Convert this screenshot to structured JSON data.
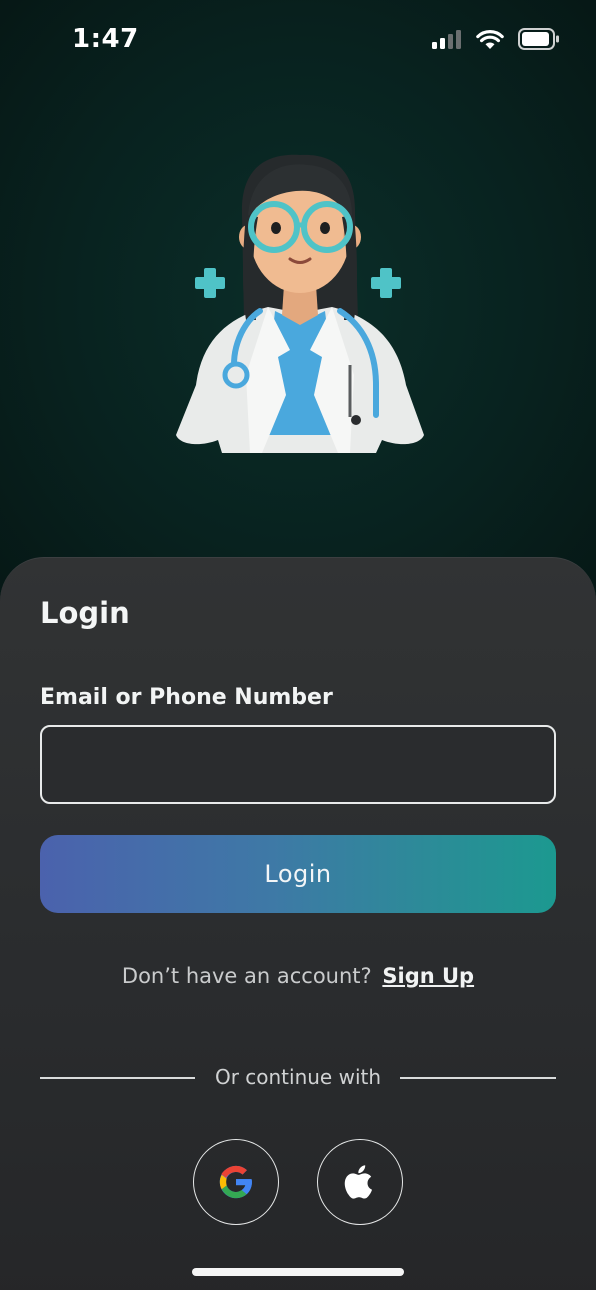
{
  "status_bar": {
    "time": "1:47",
    "icons": [
      "cellular-signal-icon",
      "wifi-icon",
      "battery-icon"
    ]
  },
  "hero": {
    "illustration": "doctor-illustration",
    "accent_color": "#4fc3c7"
  },
  "login_sheet": {
    "title": "Login",
    "field_label": "Email or Phone Number",
    "input_value": "",
    "input_placeholder": "",
    "login_button_label": "Login",
    "signup_prompt": "Don’t have an account?",
    "signup_link": "Sign Up",
    "divider_text": "Or continue with",
    "social_buttons": [
      {
        "name": "google",
        "icon": "google-icon"
      },
      {
        "name": "apple",
        "icon": "apple-icon"
      }
    ]
  },
  "colors": {
    "background": "#05110f",
    "sheet": "#2c2e30",
    "button_gradient_start": "#4b62ad",
    "button_gradient_end": "#1c9990"
  }
}
